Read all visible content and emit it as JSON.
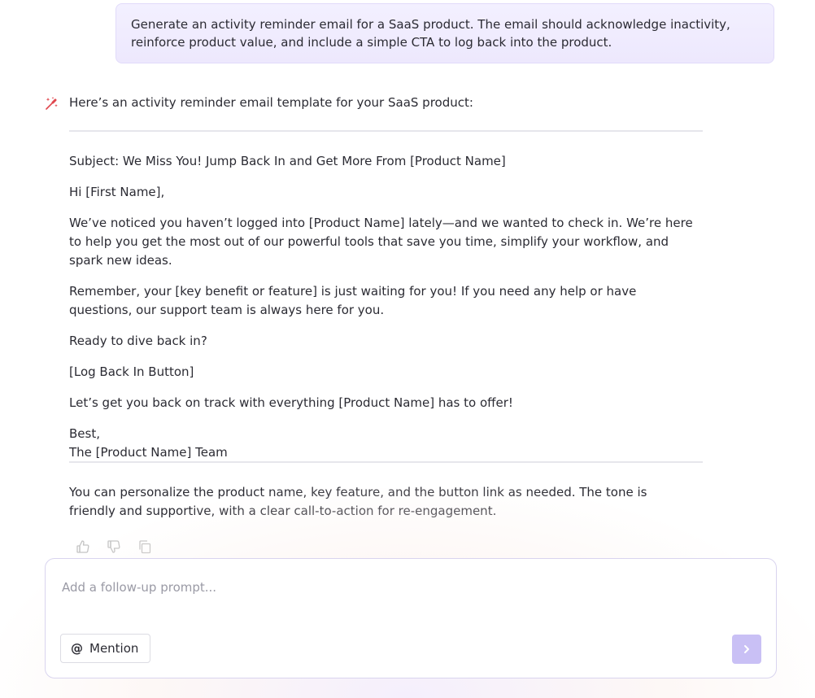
{
  "user_message": "Generate an activity reminder email for a SaaS product. The email should acknowledge inactivity, reinforce product value, and include a simple CTA to log back into the product.",
  "assistant": {
    "intro": "Here’s an activity reminder email template for your SaaS product:",
    "email": {
      "subject": "Subject: We Miss You! Jump Back In and Get More From [Product Name]",
      "greeting": "Hi [First Name],",
      "paragraph_1": "We’ve noticed you haven’t logged into [Product Name] lately—and we wanted to check in. We’re here to help you get the most out of our powerful tools that save you time, simplify your workflow, and spark new ideas.",
      "paragraph_2": "Remember, your [key benefit or feature] is just waiting for you! If you need any help or have questions, our support team is always here for you.",
      "question": "Ready to dive back in?",
      "cta": "[Log Back In Button]",
      "closing_line": "Let’s get you back on track with everything [Product Name] has to offer!",
      "signoff": "Best,",
      "signature": "The [Product Name] Team"
    },
    "note": "You can personalize the product name, key feature, and the button link as needed. The tone is friendly and supportive, with a clear call-to-action for re-engagement.",
    "actions": [
      "thumbs-up-icon",
      "thumbs-down-icon",
      "copy-icon"
    ]
  },
  "composer": {
    "placeholder": "Add a follow-up prompt...",
    "mention_label": "Mention",
    "send_icon": "chevron-right-icon"
  },
  "colors": {
    "accent": "#c9c0f5",
    "bubble": "#efebfe",
    "ai_icon": "#e0464d"
  }
}
